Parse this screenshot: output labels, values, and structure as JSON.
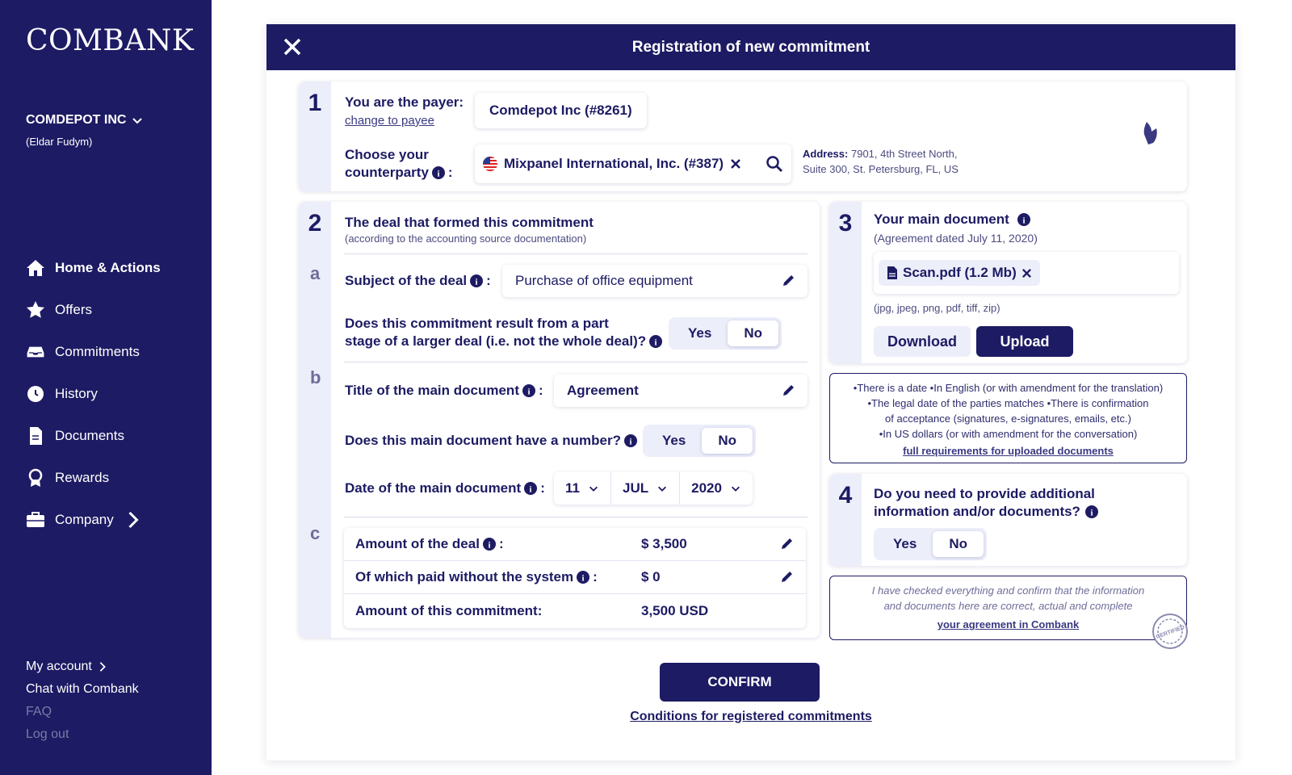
{
  "sidebar": {
    "logo": "COMBANK",
    "company": "COMDEPOT INC",
    "user": "(Eldar Fudym)",
    "nav": [
      {
        "label": "Home & Actions",
        "icon": "home-icon"
      },
      {
        "label": "Offers",
        "icon": "star-icon"
      },
      {
        "label": "Commitments",
        "icon": "inbox-icon"
      },
      {
        "label": "History",
        "icon": "history-icon"
      },
      {
        "label": "Documents",
        "icon": "document-icon"
      },
      {
        "label": "Rewards",
        "icon": "award-icon"
      },
      {
        "label": "Company",
        "icon": "briefcase-icon"
      }
    ],
    "footer": {
      "my_account": "My account",
      "chat": "Chat with Combank",
      "faq": "FAQ",
      "logout": "Log out"
    }
  },
  "modal": {
    "title": "Registration of new commitment",
    "step1": {
      "num": "1",
      "payer_label": "You are the payer:",
      "change_link": "change to payee",
      "payer_value": "Comdepot Inc (#8261)",
      "counterparty_label_1": "Choose your",
      "counterparty_label_2": "counterparty",
      "counterparty_value": "Mixpanel International, Inc. (#387)",
      "address_label": "Address:",
      "address_line1": "7901, 4th Street North,",
      "address_line2": "Suite 300, St. Petersburg, FL, US"
    },
    "step2": {
      "num": "2",
      "title": "The deal that formed this commitment",
      "subtitle": "(according to the accounting source documentation)",
      "letter_a": "a",
      "letter_b": "b",
      "letter_c": "c",
      "subject_label": "Subject of the deal",
      "subject_value": "Purchase of office equipment",
      "part_q1": "Does this commitment result from a part",
      "part_q2": "stage of a larger deal (i.e. not the whole deal)?",
      "yes": "Yes",
      "no": "No",
      "main_doc_title_label": "Title of the main document",
      "main_doc_title_value": "Agreement",
      "number_q": "Does this main document have a number?",
      "date_label": "Date of the main document",
      "date_day": "11",
      "date_month": "JUL",
      "date_year": "2020",
      "amount_label": "Amount of the deal",
      "amount_value": "$ 3,500",
      "paid_label": "Of which paid without the system",
      "paid_value": "$ 0",
      "commit_label": "Amount of this commitment:",
      "commit_value": "3,500 USD"
    },
    "step3": {
      "num": "3",
      "title": "Your main document",
      "subtitle": "(Agreement dated July 11, 2020)",
      "file": "Scan.pdf (1.2 Mb)",
      "formats": "(jpg, jpeg, png, pdf, tiff, zip)",
      "download": "Download",
      "upload": "Upload"
    },
    "requirements": {
      "line1": "•There is a date •In English (or with amendment for the translation)",
      "line2": "•The legal date of the parties matches •There is confirmation",
      "line3": "of acceptance (signatures, e-signatures, emails, etc.)",
      "line4": "•In US dollars (or with amendment for the conversation)",
      "link": "full requirements for uploaded documents"
    },
    "step4": {
      "num": "4",
      "title1": "Do you need to provide additional",
      "title2": "information and/or documents?",
      "yes": "Yes",
      "no": "No"
    },
    "confirm_note": {
      "line1": "I have checked everything and confirm that the information",
      "line2": "and documents here are correct, actual and complete",
      "link": "your agreement in Combank",
      "stamp_text": "CERTIFIED"
    },
    "confirm_button": "CONFIRM",
    "conditions_link": "Conditions for registered commitments"
  },
  "colors": {
    "brand": "#1d1b63",
    "accent_light": "#eceefa"
  }
}
